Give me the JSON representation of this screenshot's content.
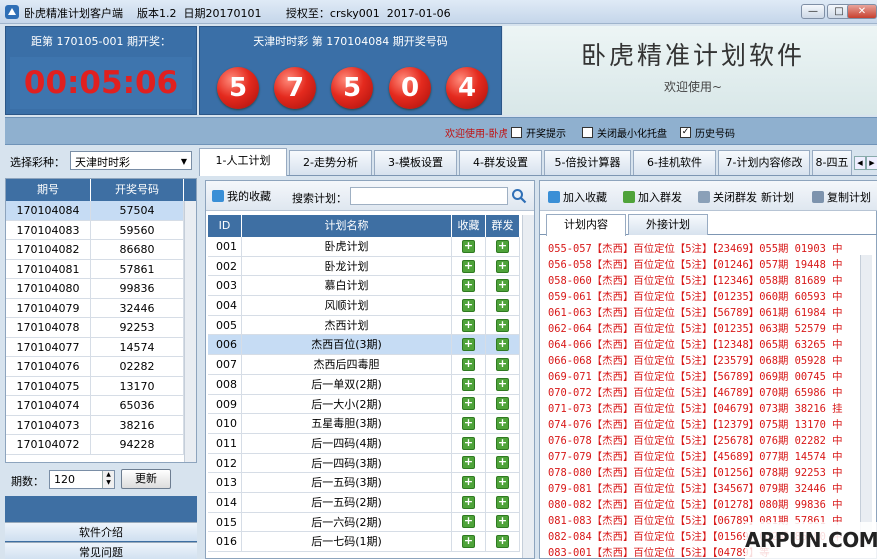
{
  "window": {
    "title": "卧虎精准计划客户端    版本1.2  日期20170101       授权至：crsky001  2017-01-06",
    "min": "—",
    "max": "□",
    "close": "✕"
  },
  "header": {
    "countdown_label": "距第 170105-001 期开奖：",
    "countdown": "00:05:06",
    "draw_label": "天津时时彩 第 170104084 期开奖号码",
    "balls": [
      "5",
      "7",
      "5",
      "0",
      "4"
    ],
    "brand_title": "卧虎精准计划软件",
    "brand_sub": "欢迎使用~"
  },
  "strip": {
    "welcome": "欢迎使用-卧虎",
    "opt1": "开奖提示",
    "opt2": "关闭最小化托盘",
    "opt3": "历史号码",
    "opt1_checked": false,
    "opt2_checked": false,
    "opt3_checked": true
  },
  "left": {
    "lottery_label": "选择彩种：",
    "lottery_value": "天津时时彩",
    "col_period": "期号",
    "col_number": "开奖号码",
    "rows": [
      [
        "170104084",
        "57504"
      ],
      [
        "170104083",
        "59560"
      ],
      [
        "170104082",
        "86680"
      ],
      [
        "170104081",
        "57861"
      ],
      [
        "170104080",
        "99836"
      ],
      [
        "170104079",
        "32446"
      ],
      [
        "170104078",
        "92253"
      ],
      [
        "170104077",
        "14574"
      ],
      [
        "170104076",
        "02282"
      ],
      [
        "170104075",
        "13170"
      ],
      [
        "170104074",
        "65036"
      ],
      [
        "170104073",
        "38216"
      ],
      [
        "170104072",
        "94228"
      ]
    ],
    "period_label": "期数：",
    "period_value": "120",
    "refresh": "更新",
    "nav": [
      "软件介绍",
      "常见问题"
    ]
  },
  "tabs": [
    "1-人工计划",
    "2-走势分析",
    "3-模板设置",
    "4-群发设置",
    "5-倍投计算器",
    "6-挂机软件",
    "7-计划内容修改",
    "8-四五"
  ],
  "mid": {
    "fav_btn": "我的收藏",
    "search_label": "搜索计划：",
    "search_value": "",
    "col_id": "ID",
    "col_name": "计划名称",
    "col_fav": "收藏",
    "col_group": "群发",
    "rows": [
      [
        "001",
        "卧虎计划"
      ],
      [
        "002",
        "卧龙计划"
      ],
      [
        "003",
        "慕白计划"
      ],
      [
        "004",
        "风顺计划"
      ],
      [
        "005",
        "杰西计划"
      ],
      [
        "006",
        "杰西百位(3期)"
      ],
      [
        "007",
        "杰西后四毒胆"
      ],
      [
        "008",
        "后一单双(2期)"
      ],
      [
        "009",
        "后一大小(2期)"
      ],
      [
        "010",
        "五星毒胆(3期)"
      ],
      [
        "011",
        "后一四码(4期)"
      ],
      [
        "012",
        "后一四码(3期)"
      ],
      [
        "013",
        "后一五码(3期)"
      ],
      [
        "014",
        "后一五码(2期)"
      ],
      [
        "015",
        "后一六码(2期)"
      ],
      [
        "016",
        "后一七码(1期)"
      ]
    ],
    "selected_index": 5
  },
  "right": {
    "btn_add_fav": "加入收藏",
    "btn_add_group": "加入群发",
    "btn_close_group": "关闭群发",
    "btn_new_plan": "新计划",
    "btn_copy_plan": "复制计划",
    "tab_content": "计划内容",
    "tab_external": "外接计划",
    "lines": [
      "055-057【杰西】百位定位【5注】【23469】055期 01903 中",
      "056-058【杰西】百位定位【5注】【01246】057期 19448 中",
      "058-060【杰西】百位定位【5注】【12346】058期 81689 中",
      "059-061【杰西】百位定位【5注】【01235】060期 60593 中",
      "061-063【杰西】百位定位【5注】【56789】061期 61984 中",
      "062-064【杰西】百位定位【5注】【01235】063期 52579 中",
      "064-066【杰西】百位定位【5注】【12348】065期 63265 中",
      "066-068【杰西】百位定位【5注】【23579】068期 05928 中",
      "069-071【杰西】百位定位【5注】【56789】069期 00745 中",
      "070-072【杰西】百位定位【5注】【46789】070期 65986 中",
      "071-073【杰西】百位定位【5注】【04679】073期 38216 挂",
      "074-076【杰西】百位定位【5注】【12379】075期 13170 中",
      "076-078【杰西】百位定位【5注】【25678】076期 02282 中",
      "077-079【杰西】百位定位【5注】【45689】077期 14574 中",
      "078-080【杰西】百位定位【5注】【01256】078期 92253 中",
      "079-081【杰西】百位定位【5注】【34567】079期 32446 中",
      "080-082【杰西】百位定位【5注】【01278】080期 99836 中",
      "081-083【杰西】百位定位【5注】【06789】081期 57861 中",
      "082-084【杰西】百位定位【5注】【01569】082期 86680 中",
      "083-001【杰西】百位定位【5注】【04789】等"
    ]
  },
  "watermark": "ARPUN.COM",
  "colors": {
    "header_blue": "#3a6fa7",
    "ball_red": "#e42a1e",
    "countdown_red": "#e02020",
    "plan_text_red": "#d81818",
    "selected_row": "#c6dcf4"
  }
}
